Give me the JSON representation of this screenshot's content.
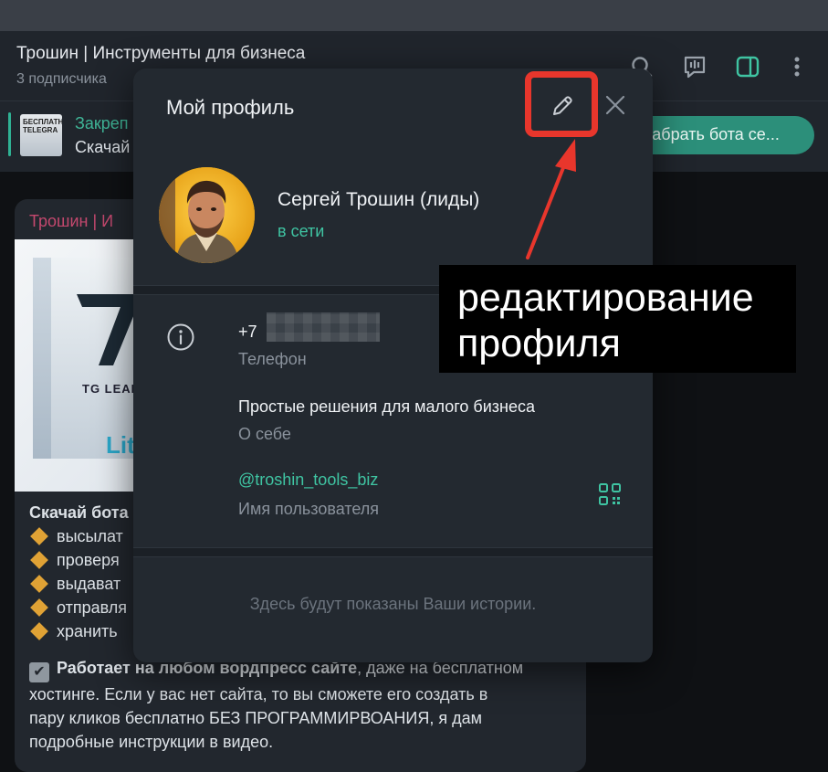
{
  "channel": {
    "title": "Трошин | Инструменты для бизнеса",
    "subscribers": "3 подписчика"
  },
  "pinned": {
    "title": "Закреп",
    "text": "Скачай",
    "thumb_text": "БЕСПЛАТН TELEGRA",
    "button_label": "забрать бота се..."
  },
  "message": {
    "sender": "Трошин | И",
    "image_brand": "TG LEAD",
    "image_badge": "Lit",
    "lines": {
      "heading": "Скачай бота",
      "b1": "высылат",
      "b2": "проверя",
      "b3": "выдават",
      "b4": "отправля",
      "b5": "хранить"
    },
    "para_bold": "Работает на любом вордпресс сайте",
    "para_l1_rest": ", даже на бесплатном",
    "para_l2": "хостинге. Если у вас нет сайта, то вы сможете его создать в",
    "para_l3": "пару кликов бесплатно БЕЗ ПРОГРАММИРВОАНИЯ, я дам",
    "para_l4": "подробные инструкции в видео."
  },
  "profile": {
    "title": "Мой профиль",
    "name": "Сергей Трошин (лиды)",
    "status": "в сети",
    "phone_prefix": "+7",
    "phone_label": "Телефон",
    "bio": "Простые решения для малого бизнеса",
    "bio_label": "О себе",
    "username": "@troshin_tools_biz",
    "username_label": "Имя пользователя",
    "stories_empty": "Здесь будут показаны Ваши истории."
  },
  "annotation": {
    "line1": "редактирование",
    "line2": "профиля",
    "color": "#e8362c"
  },
  "colors": {
    "accent": "#3fc4a2",
    "modal_bg": "#232930",
    "app_bg": "#20252c"
  },
  "icons": [
    "search-icon",
    "live-chat-icon",
    "sidebar-toggle-icon",
    "more-icon",
    "pencil-icon",
    "close-icon",
    "info-icon",
    "qr-code-icon",
    "diamond-icon",
    "checkmark-icon"
  ]
}
